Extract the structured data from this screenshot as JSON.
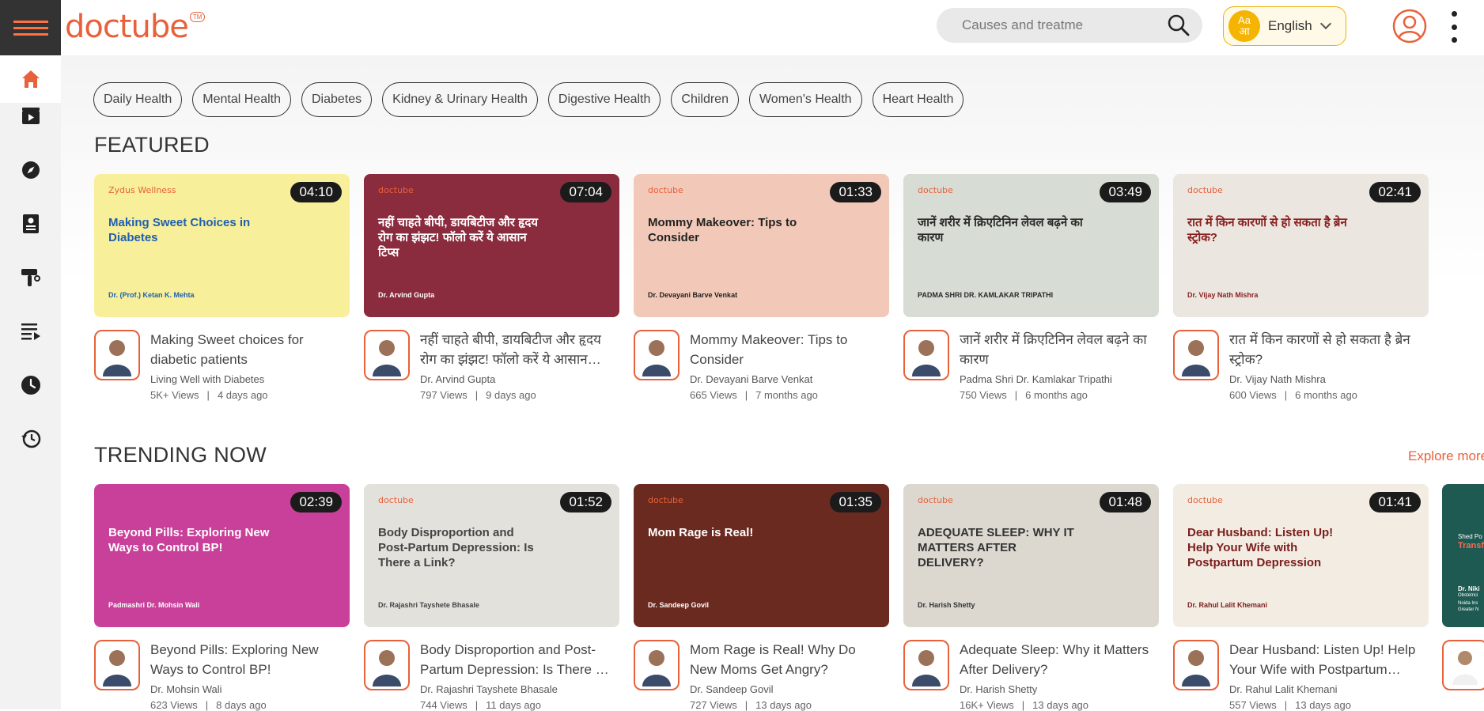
{
  "header": {
    "logo_text": "doctube",
    "logo_tm": "TM",
    "search_placeholder": "Causes and treatme",
    "language_icon_top": "Aa",
    "language_icon_bottom": "आ",
    "language_label": "English"
  },
  "sidebar": {
    "items": [
      {
        "icon": "home-icon"
      },
      {
        "icon": "video-icon"
      },
      {
        "icon": "compass-icon"
      },
      {
        "icon": "profile-card-icon"
      },
      {
        "icon": "stethoscope-icon"
      },
      {
        "icon": "playlist-icon"
      },
      {
        "icon": "clock-icon"
      },
      {
        "icon": "history-icon"
      }
    ]
  },
  "chips": [
    "Daily Health",
    "Mental Health",
    "Diabetes",
    "Kidney & Urinary Health",
    "Digestive Health",
    "Children",
    "Women's Health",
    "Heart Health"
  ],
  "sections": {
    "featured_title": "FEATURED",
    "trending_title": "TRENDING NOW",
    "explore_label": "Explore more"
  },
  "featured": [
    {
      "duration": "04:10",
      "thumb_brand": "Zydus Wellness",
      "thumb_title": "Making Sweet Choices in Diabetes",
      "thumb_sub": "Dr. (Prof.) Ketan K. Mehta",
      "title": "Making Sweet choices for diabetic patients",
      "author": "Living Well with Diabetes",
      "views": "5K+ Views",
      "age": "4 days ago",
      "bg": "#f7ef9a",
      "title_color": "#1f5fae"
    },
    {
      "duration": "07:04",
      "thumb_brand": "doctube",
      "thumb_title": "नहीं चाहते बीपी, डायबिटीज और हृदय रोग का झंझट! फॉलो करें ये आसान टिप्स",
      "thumb_sub": "Dr. Arvind Gupta",
      "title": "नहीं चाहते बीपी, डायबिटीज और हृदय रोग का झंझट! फॉलो करें ये आसान टिप्स",
      "author": "Dr. Arvind Gupta",
      "views": "797 Views",
      "age": "9 days ago",
      "bg": "#8a2b3e",
      "title_color": "#ffffff"
    },
    {
      "duration": "01:33",
      "thumb_brand": "doctube",
      "thumb_title": "Mommy Makeover: Tips to Consider",
      "thumb_sub": "Dr. Devayani Barve Venkat",
      "title": "Mommy Makeover: Tips to Consider",
      "author": "Dr. Devayani Barve Venkat",
      "views": "665 Views",
      "age": "7 months ago",
      "bg": "#f2c9b8",
      "title_color": "#222222"
    },
    {
      "duration": "03:49",
      "thumb_brand": "doctube",
      "thumb_title": "जानें शरीर में क्रिएटिनिन लेवल बढ़ने का कारण",
      "thumb_sub": "PADMA SHRI DR. KAMLAKAR TRIPATHI",
      "title": "जानें शरीर में क्रिएटिनिन लेवल बढ़ने का कारण",
      "author": "Padma Shri Dr. Kamlakar Tripathi",
      "views": "750 Views",
      "age": "6 months ago",
      "bg": "#d7dcd4",
      "title_color": "#2a2a2a"
    },
    {
      "duration": "02:41",
      "thumb_brand": "doctube",
      "thumb_title": "रात में किन कारणों से हो सकता है ब्रेन स्ट्रोक?",
      "thumb_sub": "Dr. Vijay Nath Mishra",
      "title": "रात में किन कारणों से हो सकता है ब्रेन स्ट्रोक?",
      "author": "Dr. Vijay Nath Mishra",
      "views": "600 Views",
      "age": "6 months ago",
      "bg": "#ebe6e0",
      "title_color": "#8a1f1f"
    }
  ],
  "trending": [
    {
      "duration": "02:39",
      "thumb_brand": "",
      "thumb_title": "Beyond Pills: Exploring New Ways to Control BP!",
      "thumb_sub": "Padmashri Dr. Mohsin Wali",
      "title": "Beyond Pills: Exploring New Ways to Control BP!",
      "author": "Dr. Mohsin Wali",
      "views": "623 Views",
      "age": "8 days ago",
      "bg": "#c9409a",
      "title_color": "#ffffff"
    },
    {
      "duration": "01:52",
      "thumb_brand": "doctube",
      "thumb_title": "Body Disproportion and Post-Partum Depression: Is There a Link?",
      "thumb_sub": "Dr. Rajashri Tayshete Bhasale",
      "title": "Body Disproportion and Post-Partum Depression: Is There a Link?",
      "author": "Dr. Rajashri Tayshete Bhasale",
      "views": "744 Views",
      "age": "11 days ago",
      "bg": "#e3e1dc",
      "title_color": "#444444"
    },
    {
      "duration": "01:35",
      "thumb_brand": "doctube",
      "thumb_title": "Mom Rage is Real!",
      "thumb_sub": "Dr. Sandeep Govil",
      "title": "Mom Rage is Real! Why Do New Moms Get Angry?",
      "author": "Dr. Sandeep Govil",
      "views": "727 Views",
      "age": "13 days ago",
      "bg": "#6b2a1f",
      "title_color": "#ffffff"
    },
    {
      "duration": "01:48",
      "thumb_brand": "doctube",
      "thumb_title": "ADEQUATE SLEEP: WHY IT MATTERS AFTER DELIVERY?",
      "thumb_sub": "Dr. Harish Shetty",
      "title": "Adequate Sleep: Why it Matters After Delivery?",
      "author": "Dr. Harish Shetty",
      "views": "16K+ Views",
      "age": "13 days ago",
      "bg": "#dcd8d0",
      "title_color": "#333333"
    },
    {
      "duration": "01:41",
      "thumb_brand": "doctube",
      "thumb_title": "Dear Husband: Listen Up! Help Your Wife with Postpartum Depression",
      "thumb_sub": "Dr. Rahul Lalit Khemani",
      "title": "Dear Husband: Listen Up! Help Your Wife with Postpartum Depression",
      "author": "Dr. Rahul Lalit Khemani",
      "views": "557 Views",
      "age": "13 days ago",
      "bg": "#f3ece2",
      "title_color": "#7a1d1d"
    }
  ],
  "partial_card": {
    "thumb_text_1": "Shed Po",
    "thumb_text_2": "Transf",
    "thumb_text_3": "Dr. Niki",
    "thumb_text_4": "Obstetrici",
    "thumb_text_5": "Noida Ins",
    "thumb_text_6": "Greater N",
    "bg": "#1e5a52"
  }
}
